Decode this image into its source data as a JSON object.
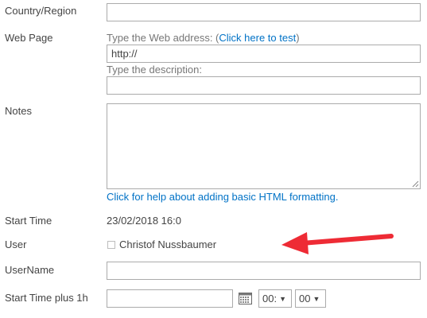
{
  "fields": {
    "country_region": {
      "label": "Country/Region",
      "value": ""
    },
    "web_page": {
      "label": "Web Page",
      "address_hint_prefix": "Type the Web address: (",
      "address_hint_link": "Click here to test",
      "address_hint_suffix": ")",
      "address_value": "http://",
      "description_hint": "Type the description:",
      "description_value": ""
    },
    "notes": {
      "label": "Notes",
      "value": "",
      "help_link": "Click for help about adding basic HTML formatting."
    },
    "start_time": {
      "label": "Start Time",
      "value": "23/02/2018 16:0"
    },
    "user": {
      "label": "User",
      "value": "Christof Nussbaumer",
      "checked": false
    },
    "username": {
      "label": "UserName",
      "value": ""
    },
    "start_time_plus_1h": {
      "label": "Start Time plus 1h",
      "date_value": "",
      "hour_value": "00:",
      "minute_value": "00"
    }
  },
  "icons": {
    "calendar": "calendar-icon",
    "dropdown": "▼",
    "annotation": "red-arrow"
  },
  "colors": {
    "link": "#0072c6",
    "border": "#ababab",
    "label": "#444444",
    "hint": "#777777",
    "arrow": "#ee2b35"
  }
}
